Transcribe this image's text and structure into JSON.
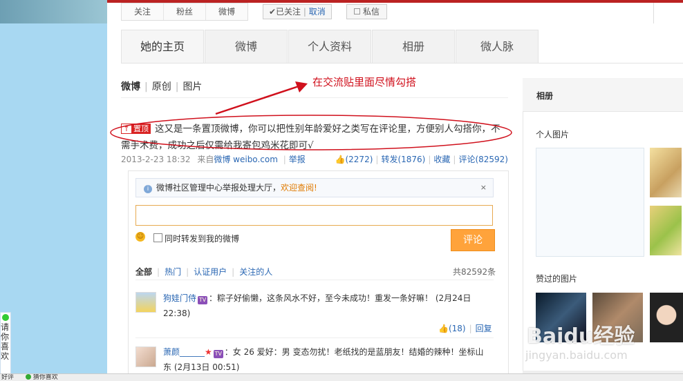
{
  "profile_buttons": [
    "关注",
    "粉丝",
    "微博"
  ],
  "follow": {
    "status": "✔已关注",
    "divider": "|",
    "cancel": "取消"
  },
  "message_label": "私信",
  "tabs": [
    "她的主页",
    "微博",
    "个人资料",
    "相册",
    "微人脉"
  ],
  "subnav": {
    "items": [
      "微博",
      "原创",
      "图片"
    ],
    "sep": "|"
  },
  "annotation": "在交流贴里面尽情勾搭",
  "post": {
    "pin_label": "置顶",
    "pin_icon": "↑",
    "text": "这又是一条置顶微博，你可以把性别年龄爱好之类写在评论里，方便别人勾搭你，不需手术费，成功之后仅需给我寄包鸡米花即可√",
    "time": "2013-2-23 18:32",
    "source_prefix": "来自",
    "source": "微博 weibo.com",
    "report": "举报",
    "like_count": "(2272)",
    "repost": "转发(1876)",
    "fav": "收藏",
    "comment": "评论(82592)"
  },
  "notice": {
    "text": "微博社区管理中心举报处理大厅，",
    "link": "欢迎查阅!",
    "close": "×"
  },
  "comment_form": {
    "checkbox_label": "同时转发到我的微博",
    "submit": "评论"
  },
  "filters": {
    "items": [
      "全部",
      "热门",
      "认证用户",
      "关注的人"
    ],
    "total": "共82592条"
  },
  "comments": [
    {
      "user": "狗娃门侍",
      "text": "：粽子好偷懒，这条风水不好，至今未成功！重发一条好嘛！ (2月24日 22:38)",
      "likes": "(18)",
      "reply": "回复"
    },
    {
      "user": "萧颜______",
      "text": "：女 26 爱好：男 变态勿扰！老纸找的是蓝朋友！结婚的辣种！坐标山东 (2月13日 00:51)"
    }
  ],
  "sidebar": {
    "title": "相册",
    "personal_photos": "个人图片",
    "liked_photos": "赞过的图片"
  },
  "left_note": {
    "text": [
      "请",
      "你",
      "喜",
      "欢"
    ]
  },
  "status_items": [
    "好评",
    "猜你喜欢"
  ],
  "watermark": {
    "logo": "Baidu经验",
    "url": "jingyan.baidu.com"
  },
  "colors": {
    "link": "#2a67b3",
    "accent_orange": "#ffa33b",
    "annotation_red": "#d0101c",
    "top_bar": "#b22222"
  }
}
